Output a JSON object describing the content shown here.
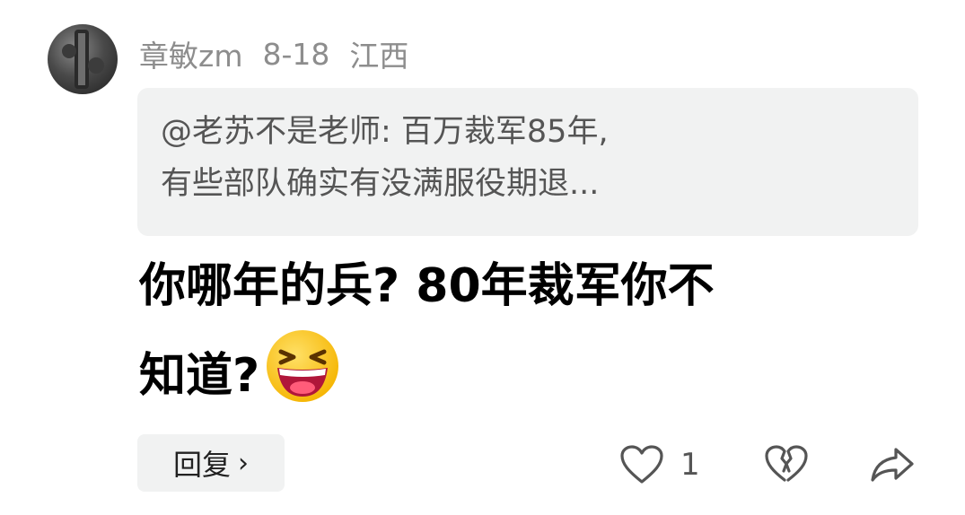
{
  "comment": {
    "username": "章敏zm",
    "date": "8-18",
    "location": "江西",
    "quote_lines": [
      "@老苏不是老师: 百万裁军85年,",
      "有些部队确实有没满服役期退..."
    ],
    "body_lines": [
      "你哪年的兵? 80年裁军你不",
      "知道?"
    ],
    "emoji": "laughing-face-emoji"
  },
  "actions": {
    "reply_label": "回复",
    "reply_chevron": "›",
    "like_count": "1",
    "icons": [
      "heart-icon",
      "broken-heart-icon",
      "share-icon"
    ]
  },
  "colors": {
    "meta_text": "#8d8d8d",
    "quote_bg": "#f1f2f2",
    "quote_text": "#555555",
    "body_text": "#000000"
  }
}
